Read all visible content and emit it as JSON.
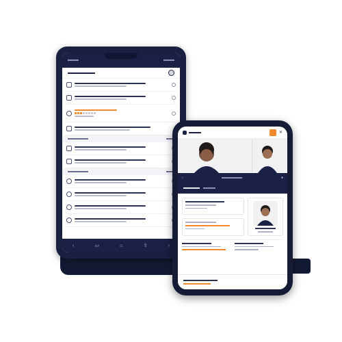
{
  "colors": {
    "navy": "#1b2145",
    "accent_orange": "#f08a2c",
    "screen_bg": "#ffffff",
    "device_frame": "#161b36"
  },
  "tablet": {
    "status_icons": [
      "menu-icon",
      "notch",
      "status-text"
    ],
    "list_rows": [
      {
        "icon": "document-icon",
        "variant": "default"
      },
      {
        "icon": "folder-icon",
        "variant": "default"
      },
      {
        "icon": "sliders-icon",
        "variant": "orange-progress"
      },
      {
        "icon": "chevron-icon",
        "variant": "default"
      },
      {
        "icon": "home-icon",
        "variant": "default"
      }
    ],
    "list_rows_2": [
      {
        "icon": "folder-icon"
      },
      {
        "icon": "lock-icon"
      },
      {
        "icon": "calendar-icon"
      }
    ],
    "list_rows_3": [
      {
        "icon": "person-icon"
      },
      {
        "icon": "person-icon"
      },
      {
        "icon": "person-icon"
      },
      {
        "icon": "person-icon"
      },
      {
        "icon": "person-icon"
      }
    ],
    "nav_icons": [
      "back-icon",
      "screen-icon",
      "home-icon",
      "share-icon",
      "forward-icon"
    ],
    "progress_steps": 8,
    "progress_active": 3
  },
  "phone": {
    "video_tiles": [
      "participant-1",
      "participant-2"
    ],
    "nav_icons": [
      "back-icon",
      "mic-icon",
      "settings-icon"
    ]
  }
}
